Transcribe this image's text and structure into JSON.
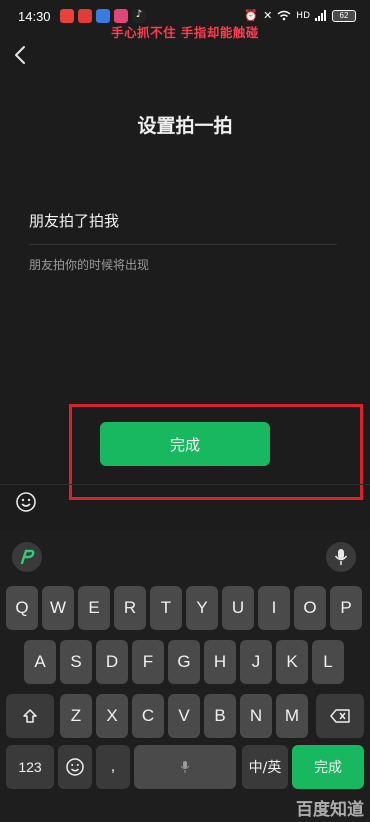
{
  "status_bar": {
    "time": "14:30",
    "network": "HD",
    "battery": "62",
    "caption": "手心抓不住 手指却能触碰"
  },
  "page": {
    "title": "设置拍一拍",
    "field_value": "朋友拍了拍我",
    "hint": "朋友拍你的时候将出现",
    "done_button": "完成"
  },
  "keyboard": {
    "row1": [
      "Q",
      "W",
      "E",
      "R",
      "T",
      "Y",
      "U",
      "I",
      "O",
      "P"
    ],
    "row2": [
      "A",
      "S",
      "D",
      "F",
      "G",
      "H",
      "J",
      "K",
      "L"
    ],
    "row3": [
      "Z",
      "X",
      "C",
      "V",
      "B",
      "N",
      "M"
    ],
    "num_key": "123",
    "lang_key": "中/英",
    "enter_key": "完成"
  },
  "watermark": "百度知道",
  "colors": {
    "accent_green": "#17b860",
    "highlight_red": "#d9232c",
    "caption_red": "#ff3b4c"
  }
}
